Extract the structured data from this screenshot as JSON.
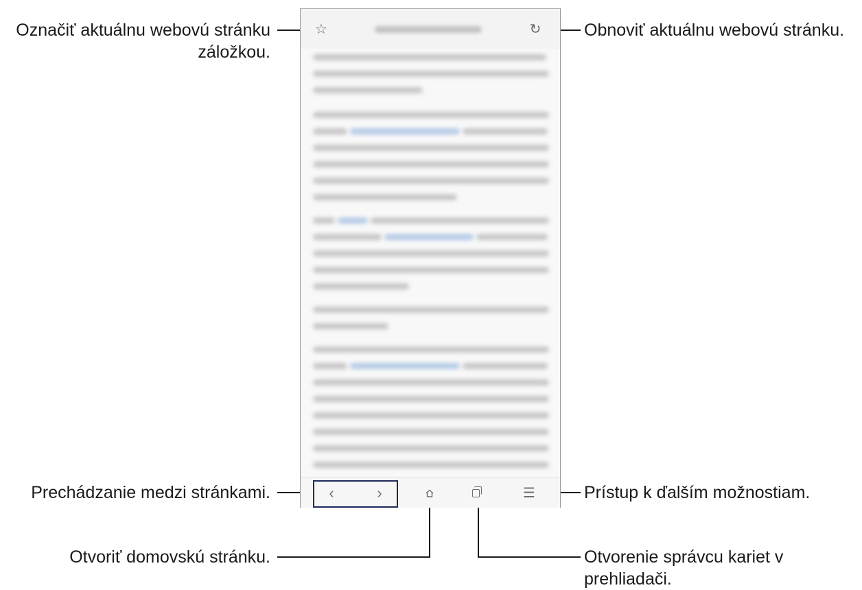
{
  "callouts": {
    "bookmark_line1": "Označiť aktuálnu webovú stránku",
    "bookmark_line2": "záložkou.",
    "refresh": "Obnoviť aktuálnu webovú stránku.",
    "navigate": "Prechádzanie medzi stránkami.",
    "more_options": "Prístup k ďalším možnostiam.",
    "home": "Otvoriť domovskú stránku.",
    "tabs_line1": "Otvorenie správcu kariet v",
    "tabs_line2": "prehliadači."
  },
  "browser": {
    "top_icons": {
      "bookmark": "star-icon",
      "refresh": "refresh-icon"
    },
    "bottom_icons": [
      "back-icon",
      "forward-icon",
      "home-icon",
      "tabs-icon",
      "menu-icon"
    ],
    "glyphs": {
      "star": "☆",
      "refresh": "↻",
      "back": "‹",
      "forward": "›",
      "menu": "☰"
    }
  },
  "colors": {
    "highlight_box": "#1f2a5a",
    "text": "#1a1a1a",
    "icon": "#6e6e6e"
  }
}
